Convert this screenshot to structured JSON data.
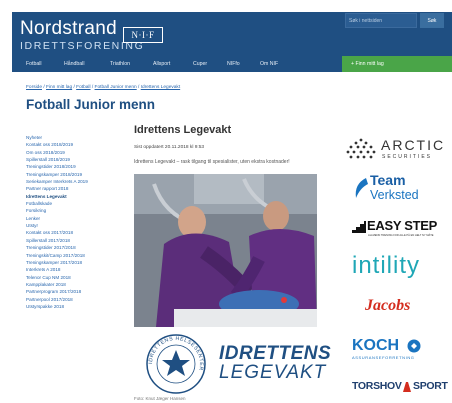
{
  "header": {
    "logo_main": "Nordstrand",
    "logo_sub": "IDRETTSFORENING",
    "nif_badge": "N·I·F",
    "search_placeholder": "Søk i nettsiden",
    "search_button": "Søk"
  },
  "nav": {
    "items": [
      "Fotball",
      "Håndball",
      "Triathlon",
      "Allsport",
      "Cuper",
      "NIFfo",
      "Om NIF"
    ],
    "find_team": "+ Finn mitt lag"
  },
  "breadcrumb": [
    "Forside",
    "Finn mitt lag",
    "Fotball",
    "Fotball Junior menn",
    "Idrettens Legevakt"
  ],
  "page_title": "Fotball Junior menn",
  "sidebar": {
    "items": [
      "Nyheter",
      "Kontakt oss 2018/2019",
      "Om oss 2018/2019",
      "Spillerstall 2018/2019",
      "Treningstider 2018/2019",
      "Treningskamper 2018/2019",
      "Seriekamper Interkrets A 2019",
      "Partner rapport 2018",
      "Idrettens Legevakt",
      "Fotballskade",
      "Forsikring",
      "Lenker",
      "Utstyr",
      "Kontakt oss 2017/2018",
      "Spillerstall 2017/2018",
      "Treningstider 2017/2018",
      "Treningskit/Camp 2017/2018",
      "Treningskamper 2017/2018",
      "Interkrets A 2018",
      "Telenor Cup NM 2018",
      "Kampplakater 2018",
      "Partnerprogram 2017/2018",
      "Partnerpool 2017/2018",
      "Utstyrspakke 2018"
    ],
    "active_index": 8
  },
  "article": {
    "title": "Idrettens Legevakt",
    "updated": "Sist oppdatert 20.11.2018 kl 9:53",
    "ingress": "Idrettens Legevakt – rask tilgang til spesialister, uten ekstra kostnader!",
    "seal_text": "IDRETTENS HELSESENTER",
    "brand_main": "IDRETTENS",
    "brand_sub": "LEGEVAKT",
    "caption": "Foto: Knut Jæger Hansen"
  },
  "sponsors": {
    "arctic": "ARCTIC",
    "arctic_sub": "SECURITIES",
    "team": "Team",
    "verksted": "Verksted",
    "easystep": "EASY STEP",
    "easystep_sub": "ALLMENN TRENING FOR ALLE PÅ EN HELT NY MÅTE",
    "intility": "intility",
    "jacobs": "Jacobs",
    "koch": "KOCH",
    "koch_sub": "ASSURANSEFORRETNING",
    "torshov": "TORSHOV",
    "torshov_sport": "SPORT"
  },
  "colors": {
    "brand_blue": "#1f4f82",
    "link_blue": "#2866ad",
    "green": "#4aa548",
    "intility_teal": "#1fa7b6",
    "jacobs_red": "#d42d1f",
    "team_blue": "#1a74c0"
  }
}
